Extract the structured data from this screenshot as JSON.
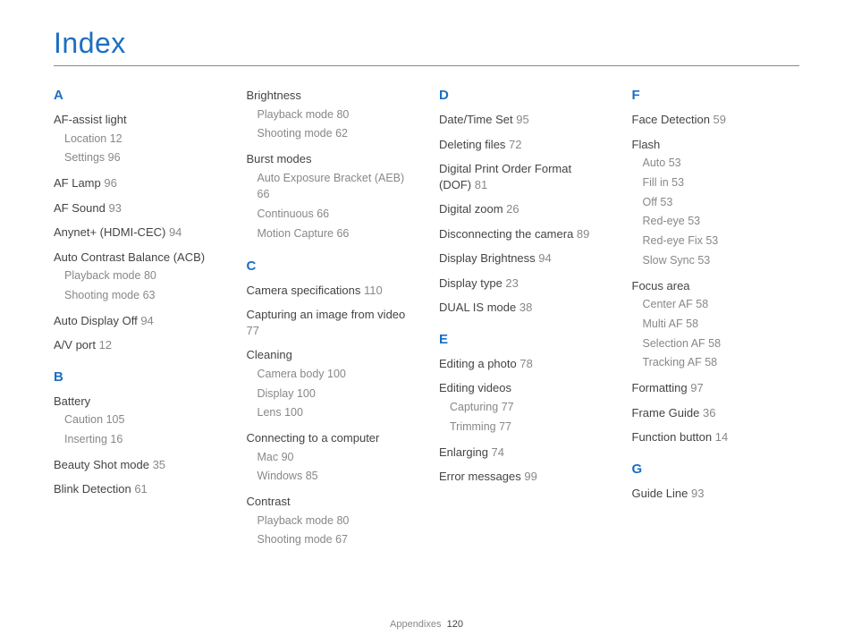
{
  "title": "Index",
  "footer": {
    "section": "Appendixes",
    "page": "120"
  },
  "columns": [
    [
      {
        "type": "letter",
        "text": "A"
      },
      {
        "type": "group",
        "term": "AF-assist light",
        "subs": [
          {
            "term": "Location",
            "page": "12"
          },
          {
            "term": "Settings",
            "page": "96"
          }
        ]
      },
      {
        "type": "entry",
        "term": "AF Lamp",
        "page": "96"
      },
      {
        "type": "entry",
        "term": "AF Sound",
        "page": "93"
      },
      {
        "type": "entry",
        "term": "Anynet+ (HDMI-CEC)",
        "page": "94"
      },
      {
        "type": "group",
        "term": "Auto Contrast Balance (ACB)",
        "subs": [
          {
            "term": "Playback mode",
            "page": "80"
          },
          {
            "term": "Shooting mode",
            "page": "63"
          }
        ]
      },
      {
        "type": "entry",
        "term": "Auto Display Off",
        "page": "94"
      },
      {
        "type": "entry",
        "term": "A/V port",
        "page": "12"
      },
      {
        "type": "letter",
        "text": "B"
      },
      {
        "type": "group",
        "term": "Battery",
        "subs": [
          {
            "term": "Caution",
            "page": "105"
          },
          {
            "term": "Inserting",
            "page": "16"
          }
        ]
      },
      {
        "type": "entry",
        "term": "Beauty Shot mode",
        "page": "35"
      },
      {
        "type": "entry",
        "term": "Blink Detection",
        "page": "61"
      }
    ],
    [
      {
        "type": "group",
        "term": "Brightness",
        "subs": [
          {
            "term": "Playback mode",
            "page": "80"
          },
          {
            "term": "Shooting mode",
            "page": "62"
          }
        ]
      },
      {
        "type": "group",
        "term": "Burst modes",
        "subs": [
          {
            "term": "Auto Exposure Bracket (AEB)",
            "page": "66"
          },
          {
            "term": "Continuous",
            "page": "66"
          },
          {
            "term": "Motion Capture",
            "page": "66"
          }
        ]
      },
      {
        "type": "letter",
        "text": "C"
      },
      {
        "type": "entry",
        "term": "Camera specifications",
        "page": "110"
      },
      {
        "type": "entry",
        "term": "Capturing an image from video",
        "page": "77"
      },
      {
        "type": "group",
        "term": "Cleaning",
        "subs": [
          {
            "term": "Camera body",
            "page": "100"
          },
          {
            "term": "Display",
            "page": "100"
          },
          {
            "term": "Lens",
            "page": "100"
          }
        ]
      },
      {
        "type": "group",
        "term": "Connecting to a computer",
        "subs": [
          {
            "term": "Mac",
            "page": "90"
          },
          {
            "term": "Windows",
            "page": "85"
          }
        ]
      },
      {
        "type": "group",
        "term": "Contrast",
        "subs": [
          {
            "term": "Playback mode",
            "page": "80"
          },
          {
            "term": "Shooting mode",
            "page": "67"
          }
        ]
      }
    ],
    [
      {
        "type": "letter",
        "text": "D"
      },
      {
        "type": "entry",
        "term": "Date/Time Set",
        "page": "95"
      },
      {
        "type": "entry",
        "term": "Deleting files",
        "page": "72"
      },
      {
        "type": "entry",
        "term": "Digital Print Order Format (DOF)",
        "page": "81"
      },
      {
        "type": "entry",
        "term": "Digital zoom",
        "page": "26"
      },
      {
        "type": "entry",
        "term": "Disconnecting the camera",
        "page": "89"
      },
      {
        "type": "entry",
        "term": "Display Brightness",
        "page": "94"
      },
      {
        "type": "entry",
        "term": "Display type",
        "page": "23"
      },
      {
        "type": "entry",
        "term": "DUAL IS mode",
        "page": "38"
      },
      {
        "type": "letter",
        "text": "E"
      },
      {
        "type": "entry",
        "term": "Editing a photo",
        "page": "78"
      },
      {
        "type": "group",
        "term": "Editing videos",
        "subs": [
          {
            "term": "Capturing",
            "page": "77"
          },
          {
            "term": "Trimming",
            "page": "77"
          }
        ]
      },
      {
        "type": "entry",
        "term": "Enlarging",
        "page": "74"
      },
      {
        "type": "entry",
        "term": "Error messages",
        "page": "99"
      }
    ],
    [
      {
        "type": "letter",
        "text": "F"
      },
      {
        "type": "entry",
        "term": "Face Detection",
        "page": "59"
      },
      {
        "type": "group",
        "term": "Flash",
        "subs": [
          {
            "term": "Auto",
            "page": "53"
          },
          {
            "term": "Fill in",
            "page": "53"
          },
          {
            "term": "Off",
            "page": "53"
          },
          {
            "term": "Red-eye",
            "page": "53"
          },
          {
            "term": "Red-eye Fix",
            "page": "53"
          },
          {
            "term": "Slow Sync",
            "page": "53"
          }
        ]
      },
      {
        "type": "group",
        "term": "Focus area",
        "subs": [
          {
            "term": "Center AF",
            "page": "58"
          },
          {
            "term": "Multi AF",
            "page": "58"
          },
          {
            "term": "Selection AF",
            "page": "58"
          },
          {
            "term": "Tracking AF",
            "page": "58"
          }
        ]
      },
      {
        "type": "entry",
        "term": "Formatting",
        "page": "97"
      },
      {
        "type": "entry",
        "term": "Frame Guide",
        "page": "36"
      },
      {
        "type": "entry",
        "term": "Function button",
        "page": "14"
      },
      {
        "type": "letter",
        "text": "G"
      },
      {
        "type": "entry",
        "term": "Guide Line",
        "page": "93"
      }
    ]
  ]
}
